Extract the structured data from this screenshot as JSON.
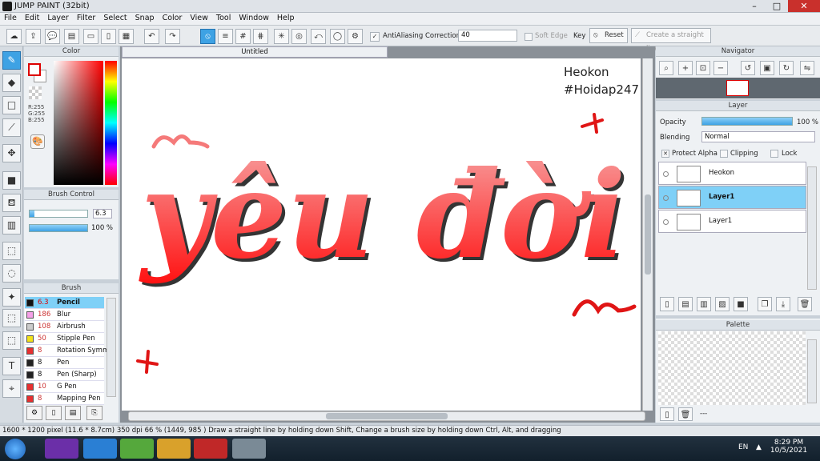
{
  "window": {
    "title": "JUMP PAINT (32bit)",
    "min": "–",
    "max": "□",
    "close": "✕"
  },
  "menu": [
    "File",
    "Edit",
    "Layer",
    "Filter",
    "Select",
    "Snap",
    "Color",
    "View",
    "Tool",
    "Window",
    "Help"
  ],
  "toolbar": {
    "antialiasing": "AntiAliasing",
    "correction_label": "Correction",
    "correction_value": "40",
    "soft_edge": "Soft Edge",
    "key_label": "Key",
    "reset": "Reset",
    "straight_line": "Create a straight line"
  },
  "panels": {
    "color": "Color",
    "brush_control": "Brush Control",
    "brush": "Brush",
    "navigator": "Navigator",
    "layer": "Layer",
    "palette": "Palette"
  },
  "color": {
    "r": "R:255",
    "g": "G:255",
    "b": "B:255"
  },
  "brush_control": {
    "size": "6.3",
    "size_fill": 0.08,
    "opacity": "100 %",
    "opacity_fill": 1.0
  },
  "brushes": [
    {
      "size": "6.3",
      "name": "Pencil",
      "color": "#111111",
      "selected": true
    },
    {
      "size": "186",
      "name": "Blur",
      "color": "#f6a0e8"
    },
    {
      "size": "108",
      "name": "Airbrush",
      "color": "#cccccc"
    },
    {
      "size": "50",
      "name": "Stipple Pen",
      "color": "#f3e21a"
    },
    {
      "size": "8",
      "name": "Rotation Symm",
      "color": "#e83030"
    },
    {
      "size": "8",
      "name": "Pen",
      "color": "#222222"
    },
    {
      "size": "8",
      "name": "Pen (Sharp)",
      "color": "#222222"
    },
    {
      "size": "10",
      "name": "G Pen",
      "color": "#e83030"
    },
    {
      "size": "8",
      "name": "Mapping Pen",
      "color": "#e83030"
    }
  ],
  "canvas": {
    "tab": "Untitled",
    "watermark1": "Heokon",
    "watermark2": "#Hoidap247",
    "art_text": "yêu đời"
  },
  "layer": {
    "opacity_label": "Opacity",
    "opacity_value": "100 %",
    "blending_label": "Blending",
    "blending_value": "Normal",
    "protect_alpha": "Protect Alpha",
    "clipping": "Clipping",
    "lock": "Lock",
    "layers": [
      {
        "name": "Heokon",
        "selected": false
      },
      {
        "name": "Layer1",
        "selected": true
      },
      {
        "name": "Layer1",
        "selected": false
      }
    ]
  },
  "palette": {
    "more": "---"
  },
  "status": "1600 * 1200 pixel   (11.6 * 8.7cm)   350 dpi   66 %   (1449, 985 )   Draw a straight line by holding down Shift, Change a brush size by holding down Ctrl, Alt, and dragging",
  "taskbar": {
    "lang": "EN",
    "time": "8:29 PM",
    "date": "10/5/2021"
  }
}
